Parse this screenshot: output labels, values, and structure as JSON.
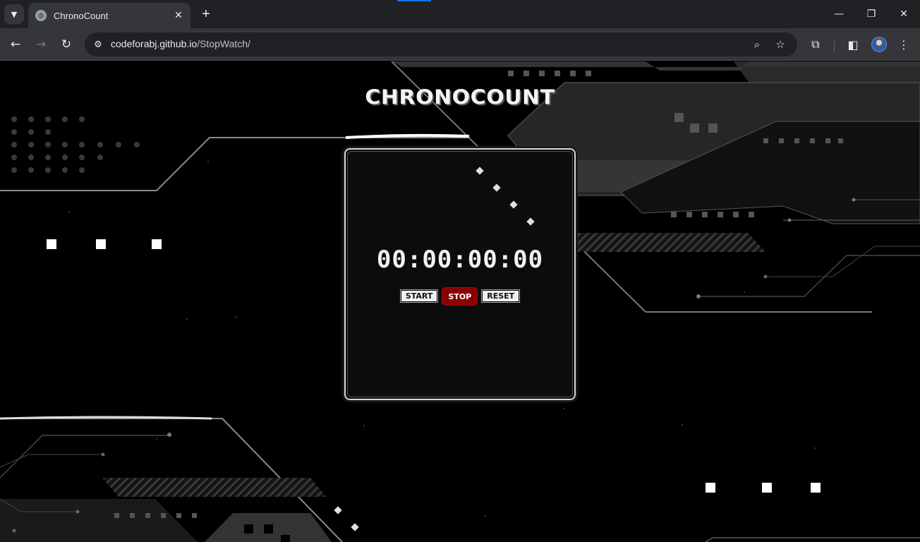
{
  "browser": {
    "tab_title": "ChronoCount",
    "url_host": "codeforabj.github.io",
    "url_path": "/StopWatch/",
    "icons": {
      "tab_search": "chevron-down-icon",
      "favicon": "globe-icon",
      "tab_close": "close-icon",
      "new_tab": "plus-icon",
      "back": "arrow-left-icon",
      "forward": "arrow-right-icon",
      "reload": "reload-icon",
      "site_info": "tune-icon",
      "zoom": "zoom-icon",
      "bookmark": "star-icon",
      "extensions": "puzzle-icon",
      "side_panel": "side-panel-icon",
      "profile": "avatar",
      "menu": "kebab-menu-icon",
      "minimize": "minimize-icon",
      "restore": "restore-icon",
      "close_window": "close-icon"
    }
  },
  "app": {
    "title": "CHRONOCOUNT",
    "time": "00:00:00:00",
    "buttons": {
      "start": "START",
      "stop": "STOP",
      "reset": "RESET"
    }
  },
  "colors": {
    "page_background": "#000000",
    "stop_button": "#8b0000",
    "chrome_dark": "#202124",
    "chrome_toolbar": "#35363a"
  }
}
